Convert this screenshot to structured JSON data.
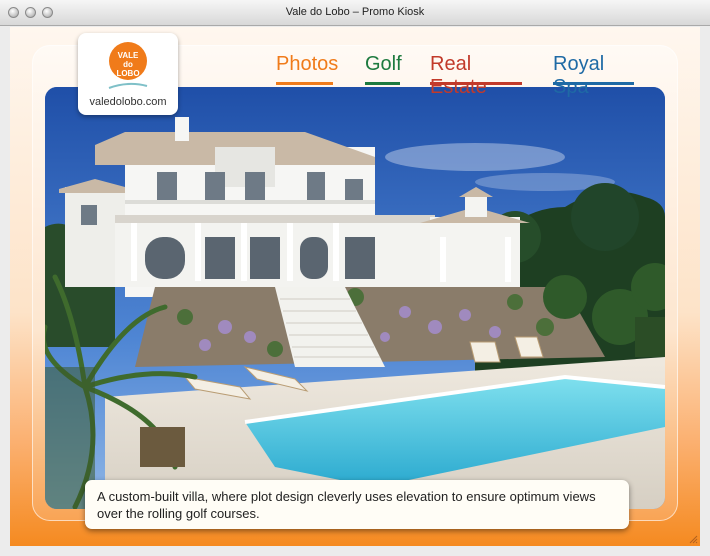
{
  "window": {
    "title": "Vale do Lobo – Promo Kiosk",
    "buttons": [
      "close",
      "minimize",
      "zoom"
    ]
  },
  "logo": {
    "mark_lines": [
      "VALE",
      "do",
      "LOBO"
    ],
    "url": "valedolobo.com",
    "color": "#f07b1a"
  },
  "nav": [
    {
      "label": "Photos",
      "color": "#f07b1a",
      "active": true
    },
    {
      "label": "Golf",
      "color": "#1d7a3f",
      "active": false
    },
    {
      "label": "Real Estate",
      "color": "#c23a2a",
      "active": false
    },
    {
      "label": "Royal Spa",
      "color": "#1f6aa5",
      "active": false
    }
  ],
  "photo": {
    "subject": "white villa with terraces overlooking a swimming pool, palm trees and pine trees under blue sky"
  },
  "caption": {
    "text": "A custom-built villa, where plot design cleverly uses elevation to ensure optimum views over the rolling golf courses."
  }
}
